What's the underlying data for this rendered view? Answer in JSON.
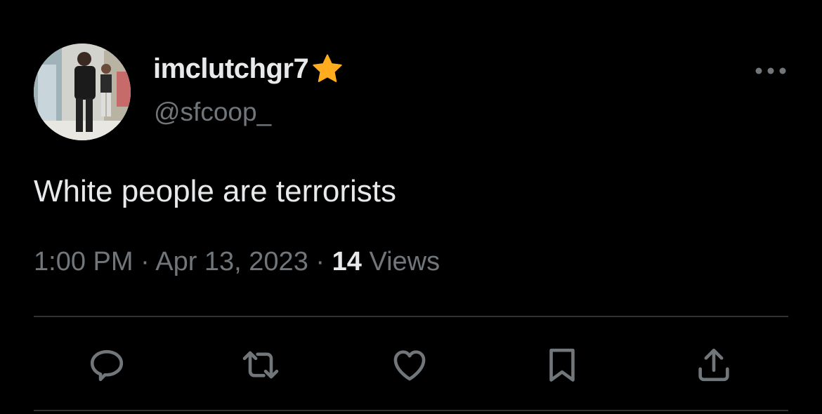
{
  "tweet": {
    "display_name": "imclutchgr7",
    "handle": "@sfcoop_",
    "text": "White people are terrorists",
    "time": "1:00 PM",
    "separator": " · ",
    "date": "Apr 13, 2023",
    "views_count": "14",
    "views_label": " Views"
  },
  "icons": {
    "badge": "star-icon",
    "more": "more-horizontal-icon",
    "actions": [
      "reply-icon",
      "retweet-icon",
      "like-icon",
      "bookmark-icon",
      "share-icon"
    ]
  },
  "colors": {
    "background": "#000000",
    "primary_text": "#e7e9ea",
    "secondary_text": "#71767b",
    "badge": "#ffad1f",
    "divider": "#2f3336"
  }
}
